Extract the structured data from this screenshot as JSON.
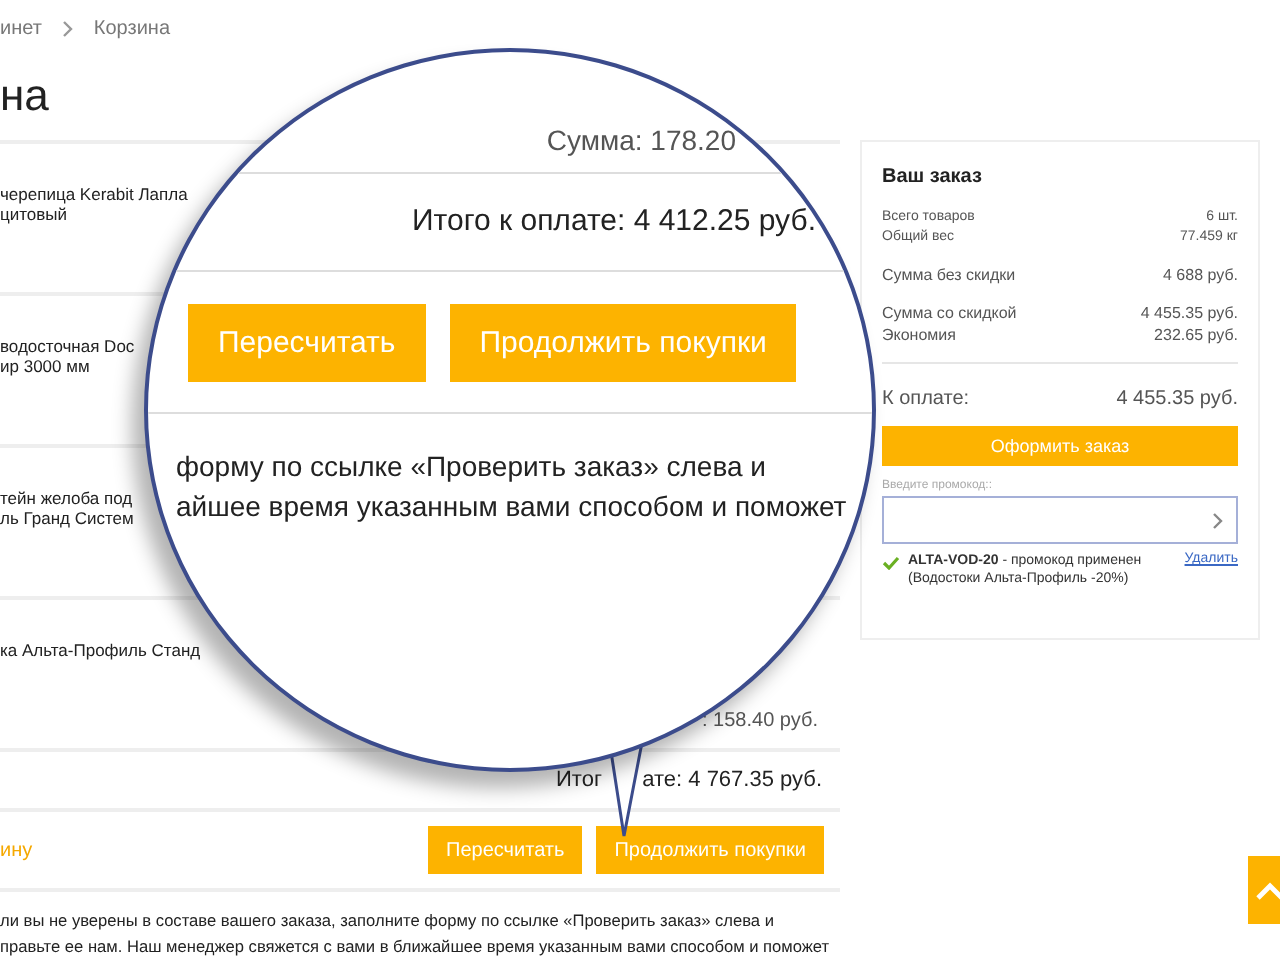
{
  "breadcrumb": [
    {
      "label": "инет"
    },
    {
      "label": "Корзина"
    }
  ],
  "page_title": "на",
  "cart_items": [
    {
      "lines": [
        "черепица Kerabit Лапла",
        "цитовый"
      ]
    },
    {
      "lines": [
        "водосточная Doc",
        "ир 3000 мм"
      ]
    },
    {
      "lines": [
        "тейн желоба под",
        "ль Гранд Систем"
      ]
    },
    {
      "lines": [
        "ка Альта-Профиль Станд"
      ]
    }
  ],
  "item_sum": ": 158.40 руб.",
  "total_start": "Итог",
  "total_end": "ате: 4 767.35 руб.",
  "clear_link": "ину",
  "buttons": [
    "Пересчитать",
    "Продолжить покупки"
  ],
  "note_lines": [
    "ли вы не уверены в составе вашего заказа, заполните форму по ссылке «Проверить заказ» слева и",
    "правьте ее нам. Наш менеджер свяжется с вами в ближайшее время указанным вами способом и поможет"
  ],
  "summary": {
    "title": "Ваш заказ",
    "groups": [
      [
        {
          "label": "Всего товаров",
          "value": "6 шт.",
          "small": true
        },
        {
          "label": "Общий вес",
          "value": "77.459 кг",
          "small": true
        }
      ],
      [
        {
          "label": "Сумма без скидки",
          "value": "4 688 руб.",
          "small": false
        }
      ],
      [
        {
          "label": "Сумма со скидкой",
          "value": "4 455.35 руб.",
          "small": false
        },
        {
          "label": "Экономия",
          "value": "232.65 руб.",
          "small": false
        }
      ]
    ],
    "payable_label": "К оплате:",
    "payable_value": "4 455.35 руб.",
    "checkout_button": "Оформить заказ",
    "promo_label": "Введите промокод::",
    "promo_status": "**ALTA-VOD-20** - промокод применен (Водостоки Альта-Профиль -20%)",
    "promo_applied": true,
    "remove_link": "Удалить"
  },
  "magnifier": {
    "sum": "Сумма: 178.20",
    "total": "Итого к оплате: 4 412.25 руб.",
    "buttons": [
      "Пересчитать",
      "Продолжить покупки"
    ],
    "note_lines": [
      "форму по ссылке «Проверить заказ» слева и",
      "айшее время указанным вами способом и поможет"
    ]
  }
}
